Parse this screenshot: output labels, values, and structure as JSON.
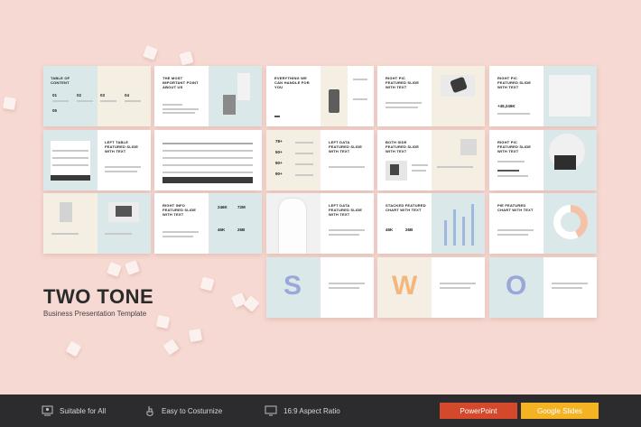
{
  "hero": {
    "title": "TWO TONE",
    "subtitle": "Business Presentation Template"
  },
  "colors": {
    "background": "#f6d9d2",
    "accent_blue": "#dbe8ea",
    "accent_cream": "#f4efe2",
    "footer": "#2c2c2e",
    "powerpoint": "#d4482c",
    "google_slides": "#f4b323"
  },
  "slides": {
    "s1": "TABLE OF CONTENT",
    "s2": "THE MOST IMPORTANT POINT ABOUT US",
    "s3": "EVERYTHING WE CAN HANDLE FOR YOU",
    "s4": "RIGHT PIC FEATURED SLIDE WITH TEXT",
    "s5": "RIGHT PIC FEATURED SLIDE WITH TEXT",
    "s5_num": "+45,246K",
    "s7": "LEFT TABLE FEATURED SLIDE WITH TEXT",
    "s9": "LEFT DATA FEATURED SLIDE WITH TEXT",
    "s9_nums": [
      "78+",
      "50+",
      "90+",
      "90+"
    ],
    "s10": "BOTH SIDE FEATURED SLIDE WITH TEXT",
    "s11": "RIGHT PIC FEATURED SLIDE WITH TEXT",
    "s13": "RIGHT INFO FEATURED SLIDE WITH TEXT",
    "s13_nums": [
      "246K",
      "72M",
      "46K",
      "26B"
    ],
    "s15": "LEFT DATA FEATURED SLIDE WITH TEXT",
    "s16": "STACKED FEATURED CHART WITH TEXT",
    "s16_nums": [
      "46K",
      "26B"
    ],
    "s17": "PIE FEATURED CHART WITH TEXT",
    "swot": [
      "S",
      "W",
      "O"
    ],
    "s1_nums": [
      "01",
      "02",
      "03",
      "04",
      "05"
    ]
  },
  "footer": {
    "feature1": "Suitable for All",
    "feature2": "Easy to Costurnize",
    "feature3": "16:9 Aspect Ratio",
    "btn_ppt": "PowerPoint",
    "btn_gs": "Google Slides"
  }
}
